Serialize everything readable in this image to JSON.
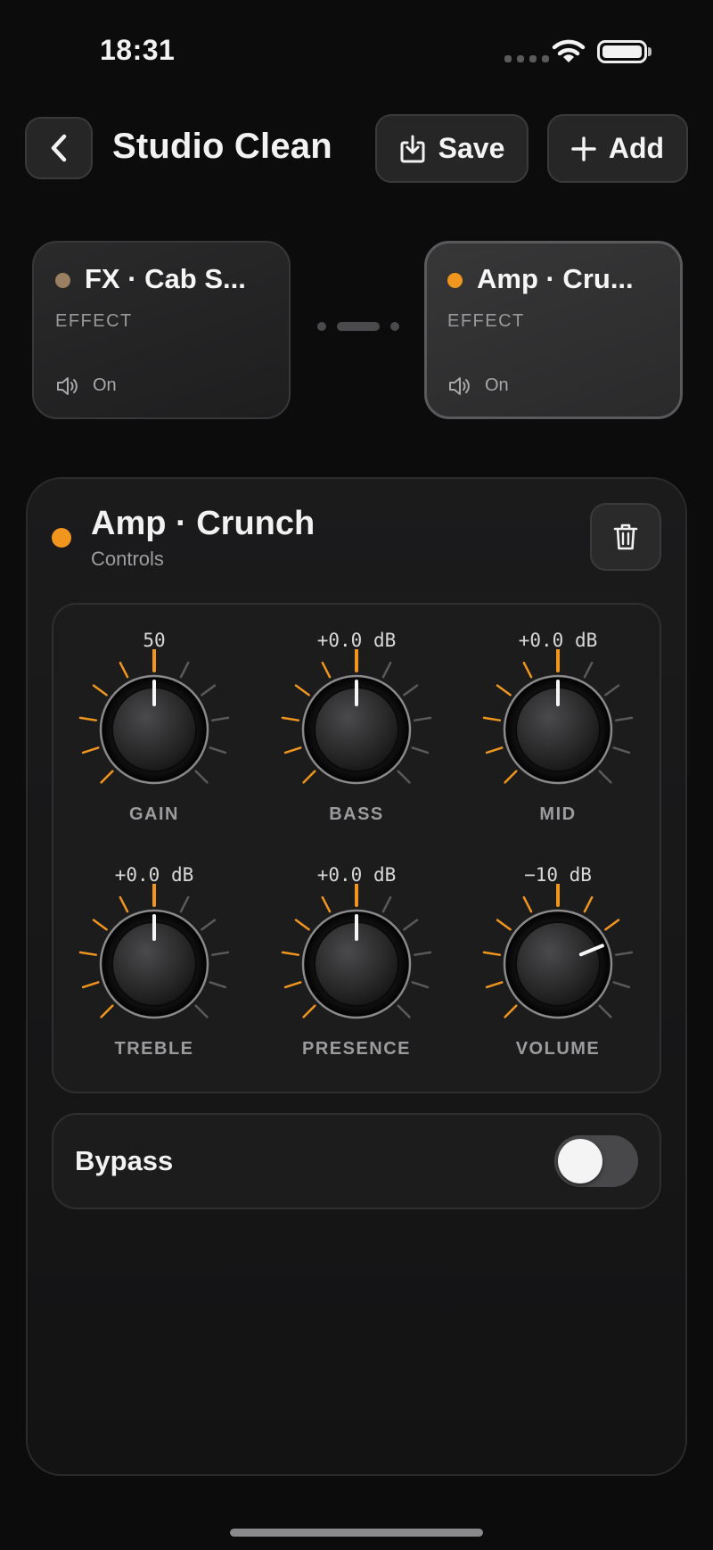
{
  "status_bar": {
    "time": "18:31"
  },
  "header": {
    "title": "Studio Clean",
    "back_icon": "chevron-left-icon",
    "save_label": "Save",
    "add_label": "Add"
  },
  "chain": [
    {
      "name": "FX · Cab S...",
      "type": "EFFECT",
      "state": "On",
      "dot_color": "#9a8060"
    },
    {
      "name": "Amp · Cru...",
      "type": "EFFECT",
      "state": "On",
      "dot_color": "#f0951d"
    }
  ],
  "panel": {
    "title": "Amp · Crunch",
    "subtitle": "Controls",
    "accent": "#f0951d",
    "knobs": [
      {
        "label": "GAIN",
        "value": "50",
        "level": 0.5
      },
      {
        "label": "BASS",
        "value": "+0.0 dB",
        "level": 0.5
      },
      {
        "label": "MID",
        "value": "+0.0 dB",
        "level": 0.5
      },
      {
        "label": "TREBLE",
        "value": "+0.0 dB",
        "level": 0.5
      },
      {
        "label": "PRESENCE",
        "value": "+0.0 dB",
        "level": 0.5
      },
      {
        "label": "VOLUME",
        "value": "−10 dB",
        "level": 0.75
      }
    ],
    "bypass_label": "Bypass",
    "bypass_on": false
  }
}
